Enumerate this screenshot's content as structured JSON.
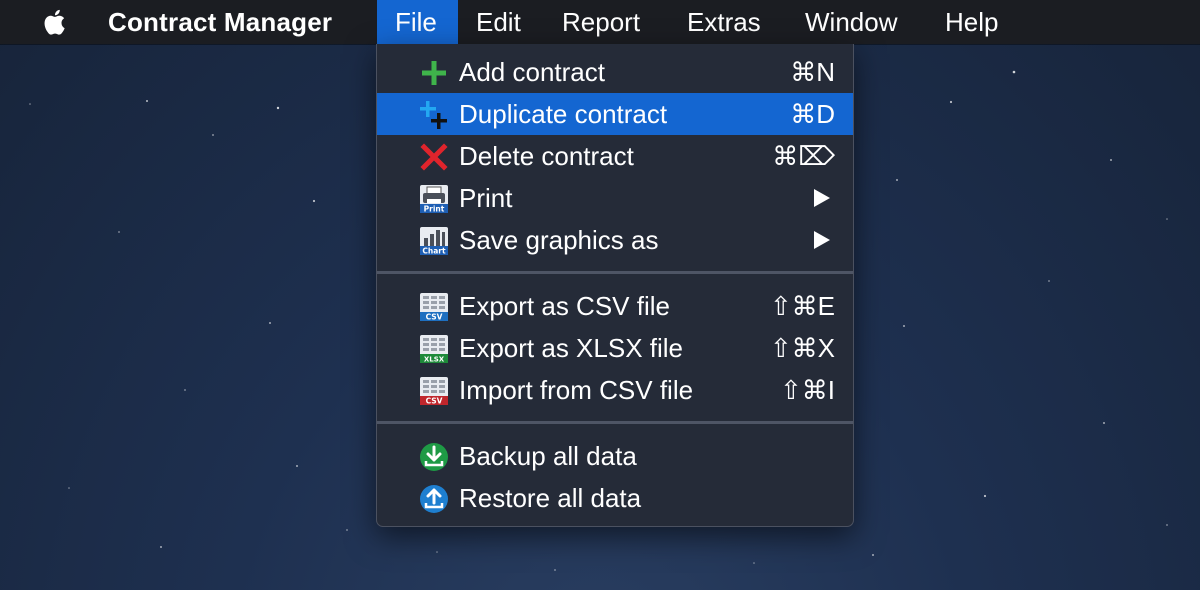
{
  "menubar": {
    "app_name": "Contract Manager",
    "items": [
      "File",
      "Edit",
      "Report",
      "Extras",
      "Window",
      "Help"
    ]
  },
  "file_menu": {
    "add": {
      "label": "Add contract",
      "shortcut": "⌘N",
      "icon": "add-icon"
    },
    "duplicate": {
      "label": "Duplicate contract",
      "shortcut": "⌘D",
      "icon": "duplicate-icon"
    },
    "delete": {
      "label": "Delete contract",
      "shortcut": "⌘⌦",
      "icon": "delete-icon"
    },
    "print": {
      "label": "Print",
      "icon": "printer-icon",
      "badge": "Print"
    },
    "save_graphics": {
      "label": "Save graphics as",
      "icon": "chart-icon",
      "badge": "Chart"
    },
    "export_csv": {
      "label": "Export as CSV file",
      "shortcut": "⇧⌘E",
      "icon": "csv-export-icon",
      "badge": "CSV"
    },
    "export_xlsx": {
      "label": "Export as XLSX file",
      "shortcut": "⇧⌘X",
      "icon": "xlsx-export-icon",
      "badge": "XLSX"
    },
    "import_csv": {
      "label": "Import from CSV file",
      "shortcut": "⇧⌘I",
      "icon": "csv-import-icon",
      "badge": "CSV"
    },
    "backup": {
      "label": "Backup all data",
      "icon": "download-icon"
    },
    "restore": {
      "label": "Restore all data",
      "icon": "upload-icon"
    }
  },
  "colors": {
    "highlight": "#1466d1",
    "menu_bg": "#252b38",
    "add_green": "#3fb44b",
    "delete_red": "#e0242c"
  }
}
